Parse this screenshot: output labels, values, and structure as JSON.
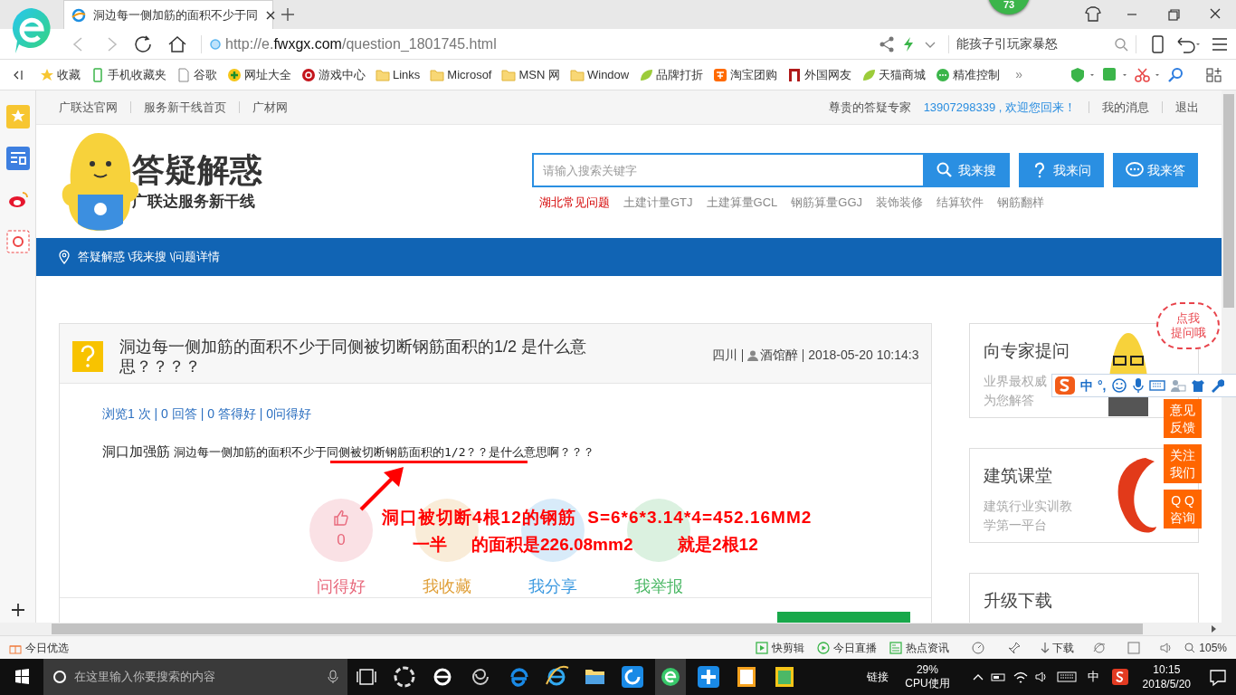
{
  "browser": {
    "tab_title": "洞边每一侧加筋的面积不少于同",
    "url_prefix": "http://e.",
    "url_domain": "fwxgx.com",
    "url_path": "/question_1801745.html",
    "search_text": "能孩子引玩家暴怒",
    "badge": "73"
  },
  "bookmarks": [
    {
      "label": "收藏",
      "kind": "star"
    },
    {
      "label": "手机收藏夹",
      "kind": "phone"
    },
    {
      "label": "谷歌",
      "kind": "page"
    },
    {
      "label": "网址大全",
      "kind": "plus"
    },
    {
      "label": "游戏中心",
      "kind": "game"
    },
    {
      "label": "Links",
      "kind": "folder"
    },
    {
      "label": "Microsof",
      "kind": "folder"
    },
    {
      "label": "MSN 网",
      "kind": "folder"
    },
    {
      "label": "Window",
      "kind": "folder"
    },
    {
      "label": "品牌打折",
      "kind": "leaf"
    },
    {
      "label": "淘宝团购",
      "kind": "tao"
    },
    {
      "label": "外国网友",
      "kind": "door"
    },
    {
      "label": "天猫商城",
      "kind": "leaf"
    },
    {
      "label": "精准控制",
      "kind": "chat"
    }
  ],
  "bookmarks_more": "»",
  "site": {
    "top_links": [
      "广联达官网",
      "服务新干线首页",
      "广材网"
    ],
    "user_prefix": "尊贵的答疑专家",
    "greeting": "13907298339 , 欢迎您回来！",
    "user_links": [
      "我的消息",
      "退出"
    ],
    "logo_title": "答疑解惑",
    "logo_subtitle": "广联达服务新干线",
    "search_placeholder": "请输入搜索关键字",
    "search_buttons": [
      {
        "label": "我来搜",
        "kind": "search"
      },
      {
        "label": "我来问",
        "kind": "ask"
      },
      {
        "label": "我来答",
        "kind": "answer"
      }
    ],
    "hot_tags": [
      {
        "label": "湖北常见问题",
        "highlight": true
      },
      {
        "label": "土建计量GTJ",
        "highlight": false
      },
      {
        "label": "土建算量GCL",
        "highlight": false
      },
      {
        "label": "钢筋算量GGJ",
        "highlight": false
      },
      {
        "label": "装饰装修",
        "highlight": false
      },
      {
        "label": "结算软件",
        "highlight": false
      },
      {
        "label": "钢筋翻样",
        "highlight": false
      }
    ],
    "breadcrumb": "答疑解惑 \\我来搜 \\问题详情"
  },
  "question": {
    "title": "洞边每一侧加筋的面积不少于同侧被切断钢筋面积的1/2 是什么意思？？？？",
    "location": "四川",
    "author": "酒馆醉",
    "time": "2018-05-20 10:14:3",
    "stats": "浏览1 次 | 0 回答 | 0 答得好 | 0问得好",
    "tag": "洞口加强筋",
    "body": "洞边每一侧加筋的面积不少于同侧被切断钢筋面积的1/2？？是什么意思啊？？？",
    "actions": [
      {
        "label": "问得好",
        "count": "0",
        "color": "#e8697c",
        "kind": "like"
      },
      {
        "label": "我收藏",
        "color": "#e0a03a",
        "kind": "star"
      },
      {
        "label": "我分享",
        "color": "#3d9ae0",
        "kind": "share"
      },
      {
        "label": "我举报",
        "color": "#4cb866",
        "kind": "report"
      }
    ]
  },
  "annotation": {
    "line_1": "洞口被切断4根12的钢筋  S=6*6*3.14*4=452.16MM2",
    "line_2a": "一半",
    "line_2b": "的面积是226.08mm2",
    "line_2c": "就是2根12"
  },
  "side_cards": [
    {
      "title": "向专家提问",
      "desc": [
        "业界最权威",
        "为您解答"
      ],
      "kind": "expert"
    },
    {
      "title": "建筑课堂",
      "desc": [
        "建筑行业实训教",
        "学第一平台"
      ],
      "kind": "class"
    },
    {
      "title": "升级下载",
      "kind": "download"
    }
  ],
  "bubble": [
    "点我",
    "提问哦"
  ],
  "float_buttons": [
    [
      "意见",
      "反馈"
    ],
    [
      "关注",
      "我们"
    ],
    [
      "Q Q",
      "咨询"
    ]
  ],
  "ime": {
    "mode": "中",
    "punct": "°,"
  },
  "status_bar": {
    "left": "今日优选",
    "items": [
      "快剪辑",
      "今日直播",
      "热点资讯"
    ],
    "download": "下载",
    "zoom": "105%"
  },
  "taskbar": {
    "search_placeholder": "在这里输入你要搜索的内容",
    "link": "链接",
    "cpu": "29%",
    "cpu_label": "CPU使用",
    "ime": "中",
    "time": "10:15",
    "date": "2018/5/20"
  }
}
